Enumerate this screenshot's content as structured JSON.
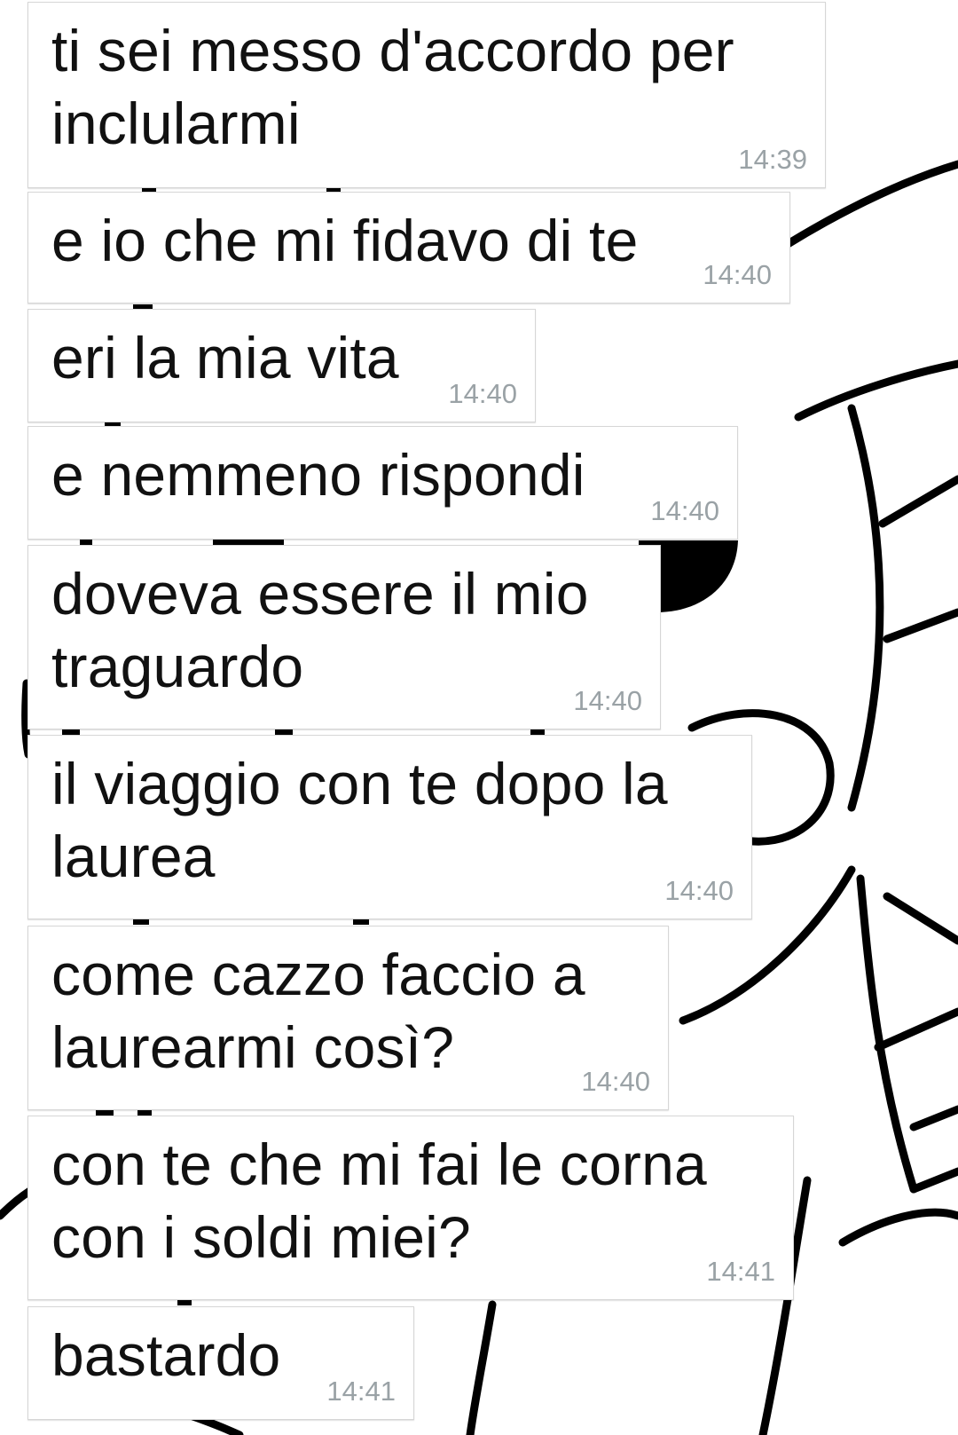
{
  "chat": {
    "messages": [
      {
        "text": "ti sei messo d'accordo per\ninclularmi",
        "time": "14:39"
      },
      {
        "text": "e io che mi fidavo di te",
        "time": "14:40"
      },
      {
        "text": "eri la mia vita",
        "time": "14:40"
      },
      {
        "text": "e nemmeno rispondi",
        "time": "14:40"
      },
      {
        "text": "doveva essere il mio\ntraguardo",
        "time": "14:40"
      },
      {
        "text": "il viaggio con te dopo la\nlaurea",
        "time": "14:40"
      },
      {
        "text": "come cazzo faccio a\nlaurearmi così?",
        "time": "14:40"
      },
      {
        "text": "con te che mi fai le corna\ncon i soldi miei?",
        "time": "14:41"
      },
      {
        "text": "bastardo",
        "time": "14:41"
      }
    ]
  },
  "colors": {
    "bubble": "#ffffff",
    "bubble_border": "#d6d6d6",
    "message_text": "#111111",
    "timestamp": "#9aa2a6",
    "wallpaper_line": "#000000"
  }
}
